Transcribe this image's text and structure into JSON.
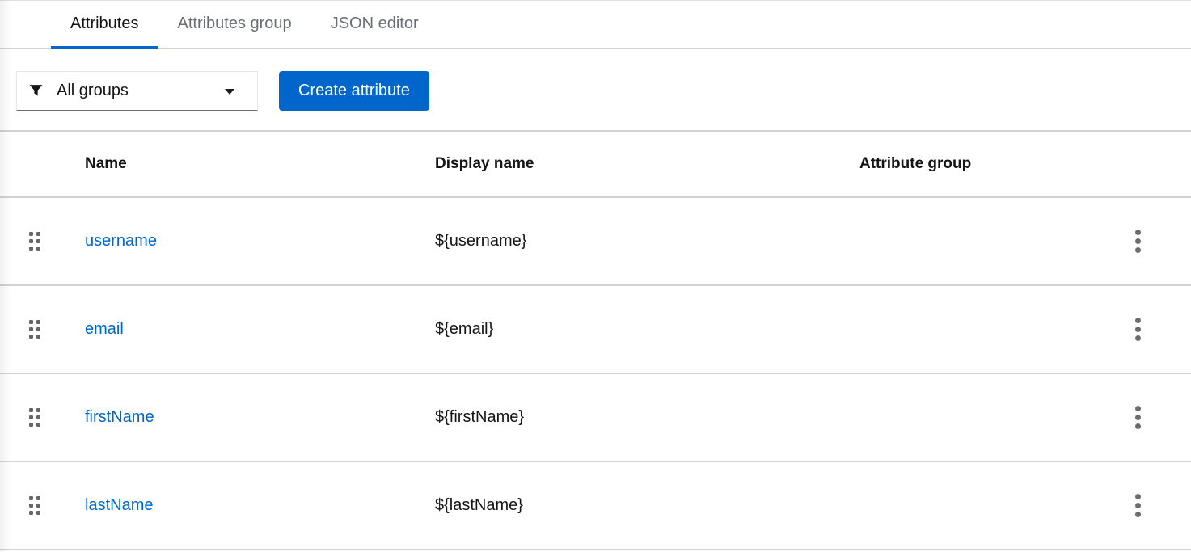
{
  "tabs": [
    {
      "id": "attributes",
      "label": "Attributes",
      "active": true
    },
    {
      "id": "attributes-group",
      "label": "Attributes group",
      "active": false
    },
    {
      "id": "json-editor",
      "label": "JSON editor",
      "active": false
    }
  ],
  "toolbar": {
    "filter_select": {
      "selected_value": "All groups",
      "icon": "filter-icon",
      "caret_icon": "caret-down-icon"
    },
    "create_button_label": "Create attribute"
  },
  "table": {
    "columns": [
      "Name",
      "Display name",
      "Attribute group"
    ],
    "row_icons": {
      "drag": "grip-dots-icon",
      "actions": "kebab-icon"
    },
    "rows": [
      {
        "name": "username",
        "display_name": "${username}",
        "attribute_group": ""
      },
      {
        "name": "email",
        "display_name": "${email}",
        "attribute_group": ""
      },
      {
        "name": "firstName",
        "display_name": "${firstName}",
        "attribute_group": ""
      },
      {
        "name": "lastName",
        "display_name": "${lastName}",
        "attribute_group": ""
      }
    ]
  },
  "colors": {
    "primary_blue": "#0066cc",
    "link_blue": "#0066cc",
    "text_dark": "#151515",
    "text_muted": "#6a6e73",
    "border_gray": "#d2d2d2",
    "icon_gray": "#62676c"
  }
}
